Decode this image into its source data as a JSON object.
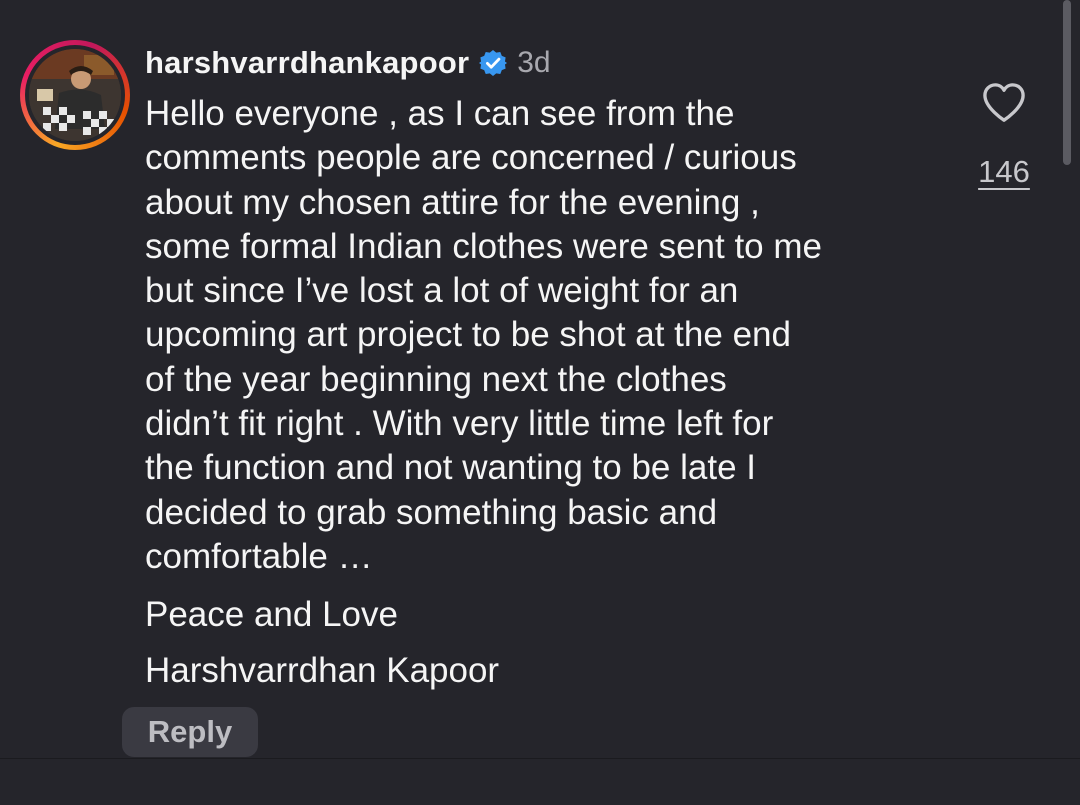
{
  "comment": {
    "username": "harshvarrdhankapoor",
    "verified": true,
    "time": "3d",
    "text": "Hello everyone , as I can see from the\ncomments people are concerned / curious\nabout my chosen attire for the evening ,\nsome formal Indian clothes were sent to me\nbut since I’ve lost a lot of weight for an\nupcoming art project to be shot at the end\nof the year beginning next the clothes\ndidn’t fit right . With very little time left for\nthe function and not wanting to be late I\ndecided to grab something basic and\ncomfortable …",
    "sign_off": "Peace and Love",
    "signature": "Harshvarrdhan Kapoor",
    "reply_label": "Reply"
  },
  "likes": {
    "count": "146",
    "icon": "heart-outline-icon"
  },
  "colors": {
    "background": "#25252b",
    "verified_blue": "#3897f0",
    "text": "#f5f5f5",
    "muted": "#a8a8ae"
  }
}
